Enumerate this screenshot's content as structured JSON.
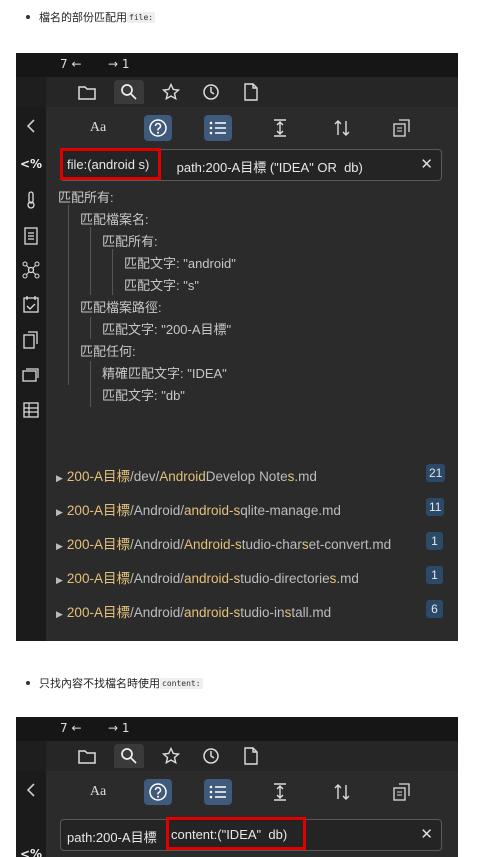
{
  "doc": {
    "bullet1_text": "檔名的部份匹配用",
    "bullet1_code": "file:",
    "bullet2_text": "只找內容不找檔名時使用",
    "bullet2_code": "content:"
  },
  "screenshot1": {
    "nav_back": "7 ←",
    "nav_forward": "→ 1",
    "tabs": [
      {
        "name": "files-icon"
      },
      {
        "name": "search-icon",
        "active": true
      },
      {
        "name": "bookmark-star-icon"
      },
      {
        "name": "recent-clock-icon"
      },
      {
        "name": "page-icon"
      }
    ],
    "toolbar": {
      "match_case_label": "Aa"
    },
    "search": {
      "query_part1": "file:(android s)",
      "query_part2": " path:200-A目標 (\"IDEA\" OR  db)"
    },
    "query_tree": [
      "匹配所有:",
      "匹配檔案名:",
      "匹配所有:",
      "匹配文字: \"android\"",
      "匹配文字: \"s\"",
      "匹配檔案路徑:",
      "匹配文字: \"200-A目標\"",
      "匹配任何:",
      "精確匹配文字: \"IDEA\"",
      "匹配文字: \"db\""
    ],
    "results": [
      {
        "parts": [
          [
            "200-A目標",
            "m"
          ],
          [
            "/dev/",
            ""
          ],
          [
            "Android",
            "m"
          ],
          [
            "Develop Note",
            ""
          ],
          [
            "s",
            "m"
          ],
          [
            ".md",
            ""
          ]
        ],
        "count": "21"
      },
      {
        "parts": [
          [
            "200-A目標",
            "m"
          ],
          [
            "/Android/",
            ""
          ],
          [
            "android-s",
            "m"
          ],
          [
            "qlite-manage.md",
            ""
          ]
        ],
        "count": "11"
      },
      {
        "parts": [
          [
            "200-A目標",
            "m"
          ],
          [
            "/Android/",
            ""
          ],
          [
            "Android-s",
            "m"
          ],
          [
            "tudio-char",
            ""
          ],
          [
            "s",
            "m"
          ],
          [
            "et-convert.md",
            ""
          ]
        ],
        "count": "1"
      },
      {
        "parts": [
          [
            "200-A目標",
            "m"
          ],
          [
            "/Android/",
            ""
          ],
          [
            "android-s",
            "m"
          ],
          [
            "tudio-directorie",
            ""
          ],
          [
            "s",
            "m"
          ],
          [
            ".md",
            ""
          ]
        ],
        "count": "1"
      },
      {
        "parts": [
          [
            "200-A目標",
            "m"
          ],
          [
            "/Android/",
            ""
          ],
          [
            "android-s",
            "m"
          ],
          [
            "tudio-in",
            ""
          ],
          [
            "s",
            "m"
          ],
          [
            "tall.md",
            ""
          ]
        ],
        "count": "6"
      }
    ]
  },
  "screenshot2": {
    "nav_back": "7 ←",
    "nav_forward": "→ 1",
    "toolbar": {
      "match_case_label": "Aa"
    },
    "search": {
      "query_part1": "path:200-A目標 ",
      "query_part2": "content:(\"IDEA\"  db)"
    },
    "rail_first_label": "<%"
  },
  "colors": {
    "highlight_box": "#e00000",
    "match_text": "#e5c07b",
    "badge_bg": "#2a4a68",
    "active_tool": "#3f5a7a"
  }
}
